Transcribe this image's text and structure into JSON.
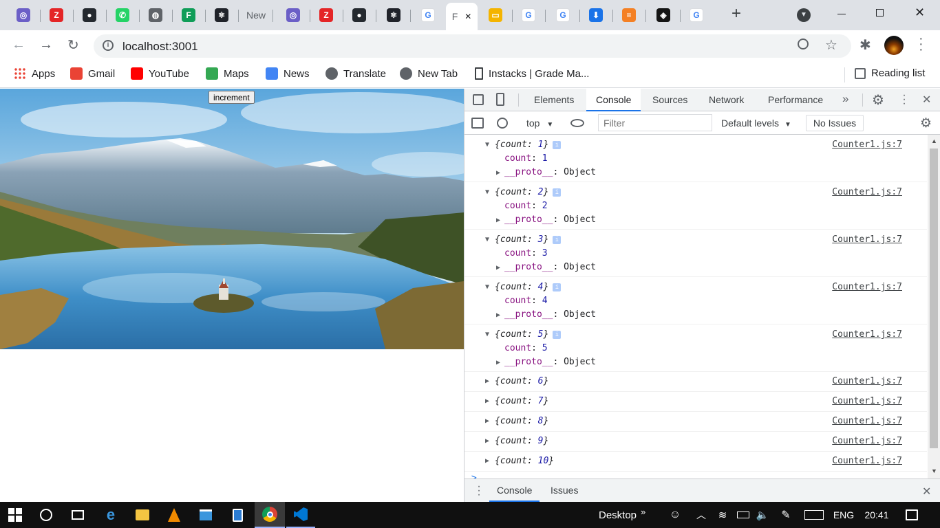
{
  "browser": {
    "tabs": [
      {
        "icon": "elephant-icon",
        "title": ""
      },
      {
        "icon": "zoho-z-icon",
        "title": ""
      },
      {
        "icon": "github-icon",
        "title": ""
      },
      {
        "icon": "whatsapp-icon",
        "title": ""
      },
      {
        "icon": "globe-icon",
        "title": ""
      },
      {
        "icon": "sheets-icon",
        "title": ""
      },
      {
        "icon": "react-icon",
        "title": ""
      },
      {
        "icon": "",
        "title": "New"
      },
      {
        "icon": "elephant-icon",
        "title": ""
      },
      {
        "icon": "zoho-z-icon",
        "title": ""
      },
      {
        "icon": "github-icon",
        "title": ""
      },
      {
        "icon": "react-icon",
        "title": ""
      },
      {
        "icon": "google-icon",
        "title": ""
      },
      {
        "icon": "",
        "title": "F",
        "active": true
      },
      {
        "icon": "slides-icon",
        "title": ""
      },
      {
        "icon": "google-icon",
        "title": ""
      },
      {
        "icon": "google-icon",
        "title": ""
      },
      {
        "icon": "download-icon",
        "title": ""
      },
      {
        "icon": "stackoverflow-icon",
        "title": ""
      },
      {
        "icon": "codesandbox-icon",
        "title": ""
      },
      {
        "icon": "google-icon",
        "title": ""
      }
    ],
    "url": "localhost:3001",
    "bookmarks": [
      {
        "label": "Apps",
        "icon": "apps-grid-icon"
      },
      {
        "label": "Gmail",
        "icon": "gmail-icon"
      },
      {
        "label": "YouTube",
        "icon": "youtube-icon"
      },
      {
        "label": "Maps",
        "icon": "maps-icon"
      },
      {
        "label": "News",
        "icon": "news-icon"
      },
      {
        "label": "Translate",
        "icon": "globe-icon"
      },
      {
        "label": "New Tab",
        "icon": "globe-icon"
      },
      {
        "label": "Instacks | Grade Ma...",
        "icon": "bookmark-doc-icon"
      }
    ],
    "reading_list": "Reading list"
  },
  "page": {
    "increment_label": "increment"
  },
  "devtools": {
    "tabs": [
      "Elements",
      "Console",
      "Sources",
      "Network",
      "Performance"
    ],
    "active_tab": "Console",
    "context": "top",
    "filter_placeholder": "Filter",
    "levels": "Default levels",
    "issues": "No Issues",
    "prompt": ">",
    "drawer_tabs": [
      "Console",
      "Issues"
    ],
    "entries": [
      {
        "summary_key": "count",
        "value": "1",
        "expanded": true,
        "source": "Counter1.js:7",
        "proto": "__proto__",
        "proto_value": "Object"
      },
      {
        "summary_key": "count",
        "value": "2",
        "expanded": true,
        "source": "Counter1.js:7",
        "proto": "__proto__",
        "proto_value": "Object"
      },
      {
        "summary_key": "count",
        "value": "3",
        "expanded": true,
        "source": "Counter1.js:7",
        "proto": "__proto__",
        "proto_value": "Object"
      },
      {
        "summary_key": "count",
        "value": "4",
        "expanded": true,
        "source": "Counter1.js:7",
        "proto": "__proto__",
        "proto_value": "Object"
      },
      {
        "summary_key": "count",
        "value": "5",
        "expanded": true,
        "source": "Counter1.js:7",
        "proto": "__proto__",
        "proto_value": "Object"
      },
      {
        "summary_key": "count",
        "value": "6",
        "expanded": false,
        "source": "Counter1.js:7"
      },
      {
        "summary_key": "count",
        "value": "7",
        "expanded": false,
        "source": "Counter1.js:7"
      },
      {
        "summary_key": "count",
        "value": "8",
        "expanded": false,
        "source": "Counter1.js:7"
      },
      {
        "summary_key": "count",
        "value": "9",
        "expanded": false,
        "source": "Counter1.js:7"
      },
      {
        "summary_key": "count",
        "value": "10",
        "expanded": false,
        "source": "Counter1.js:7"
      }
    ]
  },
  "taskbar": {
    "desktop_label": "Desktop",
    "language": "ENG",
    "time": "20:41"
  }
}
